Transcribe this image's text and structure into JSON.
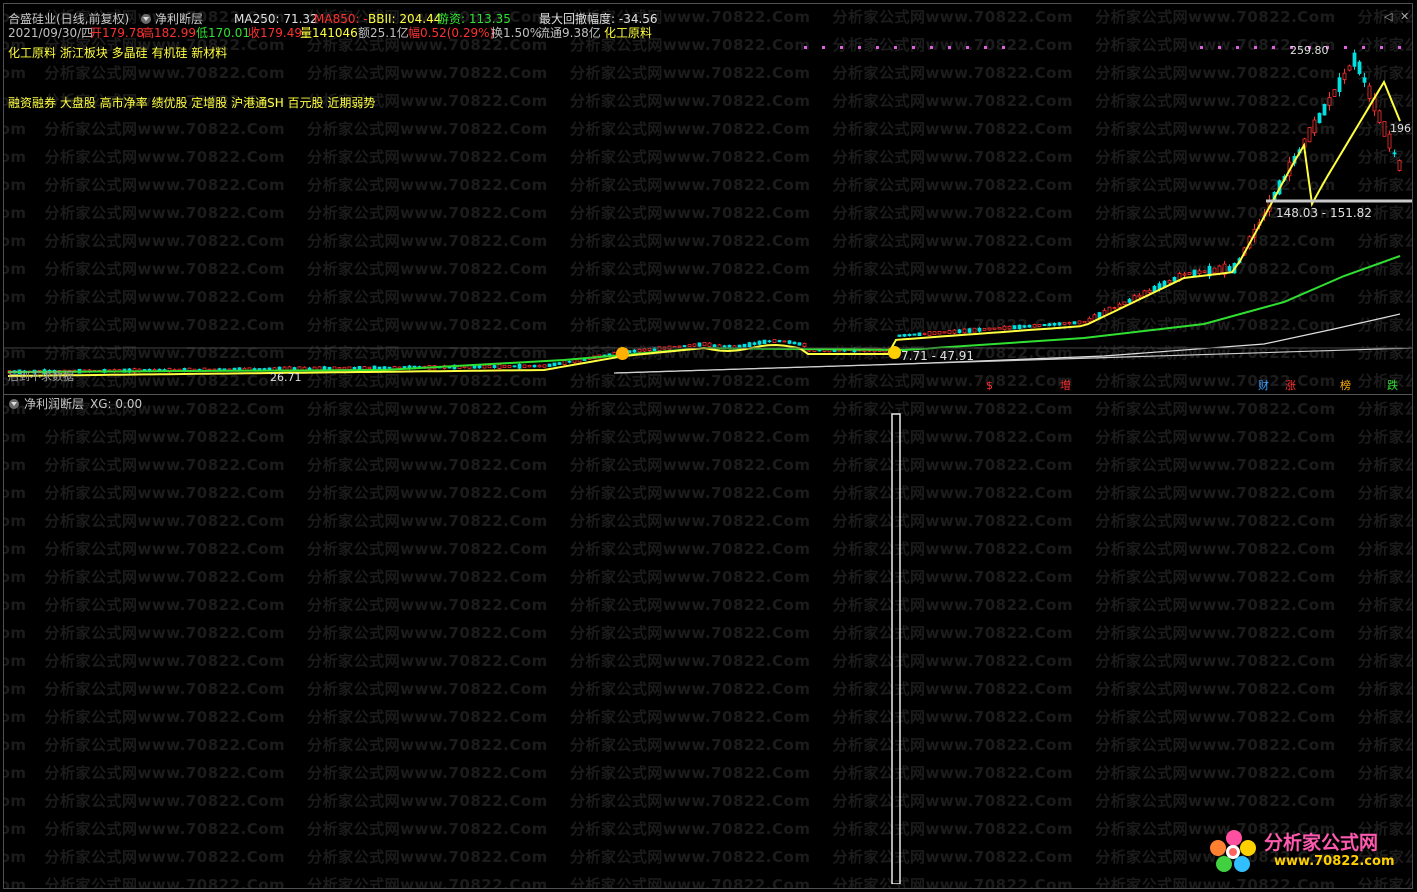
{
  "main_header": {
    "title": "合盛硅业(日线,前复权)",
    "indicator_name": "净利断层",
    "ma250": "MA250: 71.32",
    "ma850": "MA850: -",
    "bbii": "BBII: 204.44",
    "youzi": "游资: 113.35",
    "max_drawdown": "最大回撤幅度: -34.56"
  },
  "quote_line": {
    "date": "2021/09/30/四",
    "open": "开179.78",
    "high": "高182.99",
    "low": "低170.01",
    "close": "收179.49",
    "volume": "量141046",
    "amount": "额25.1亿",
    "change": "幅0.52(0.29%)",
    "turnover": "换1.50%",
    "float": "流通9.38亿",
    "sector": "化工原料"
  },
  "concept_line_1": "化工原料 浙江板块 多晶硅 有机硅 新材料",
  "concept_line_2": "融资融券 大盘股 高市净率 绩优股 定增股 沪港通SH 百元股 近期弱势",
  "price_labels": {
    "high_mark": "259.80",
    "right_mark": "196",
    "band_label": "148.03 - 151.82",
    "low_band": "7.71 - 47.91",
    "left_low": "26.71",
    "left_note": "后到不求数据"
  },
  "event_markers": [
    {
      "label": "$",
      "color": "#ff3030"
    },
    {
      "label": "增",
      "color": "#ff3030"
    },
    {
      "label": "财",
      "color": "#3aa0ff"
    },
    {
      "label": "涨",
      "color": "#ff3030"
    },
    {
      "label": "榜",
      "color": "#ffb000"
    },
    {
      "label": "跌",
      "color": "#30e030"
    }
  ],
  "sub_header": {
    "title": "净利润断层",
    "xg": "XG: 0.00"
  },
  "watermark": {
    "text": "分析家公式网www.70822.Com",
    "edge": ".com"
  },
  "logo": {
    "brand": "分析家公式网",
    "url": "www.70822.com"
  },
  "colors": {
    "up": "#ff3030",
    "down": "#00e0e0",
    "ma_yellow": "#ffff40",
    "ma_green": "#30e030",
    "ma_white": "#e0e0e0",
    "label_magenta": "#e060e0"
  }
}
